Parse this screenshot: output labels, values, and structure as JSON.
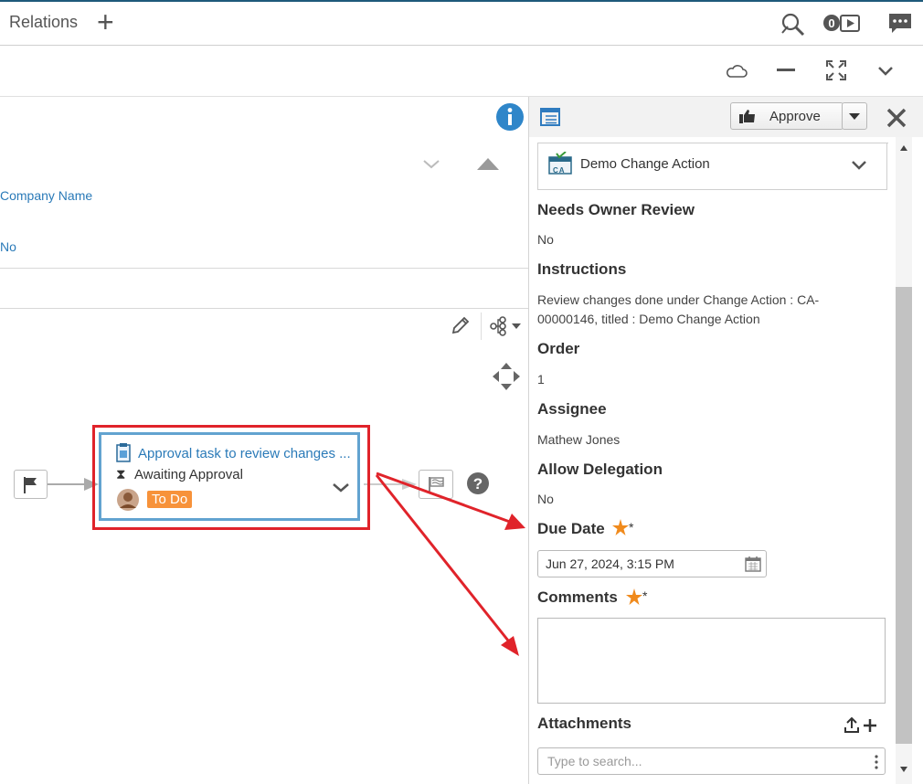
{
  "topbar": {
    "title": "Relations"
  },
  "leftpanel": {
    "company_name": "Company Name",
    "no_value": "No"
  },
  "workflow": {
    "task_title": "Approval task to review changes ...",
    "task_status": "Awaiting Approval",
    "task_state": "To Do"
  },
  "rightpanel": {
    "approve_label": "Approve",
    "object_name": "Demo Change Action",
    "object_badge": "CA",
    "fields": {
      "needs_owner_review_label": "Needs Owner Review",
      "needs_owner_review_value": "No",
      "instructions_label": "Instructions",
      "instructions_value": "Review changes done under Change Action : CA-00000146, titled : Demo Change Action",
      "order_label": "Order",
      "order_value": "1",
      "assignee_label": "Assignee",
      "assignee_value": "Mathew Jones",
      "allow_delegation_label": "Allow Delegation",
      "allow_delegation_value": "No",
      "due_date_label": "Due Date",
      "due_date_value": "Jun 27, 2024, 3:15 PM",
      "comments_label": "Comments",
      "comments_value": "",
      "attachments_label": "Attachments",
      "attachments_placeholder": "Type to search...",
      "required_mark": "*"
    }
  },
  "colors": {
    "accent": "#2a7ab8",
    "required": "#f08a1c",
    "highlight": "#e0232a",
    "todo": "#f7923a"
  }
}
